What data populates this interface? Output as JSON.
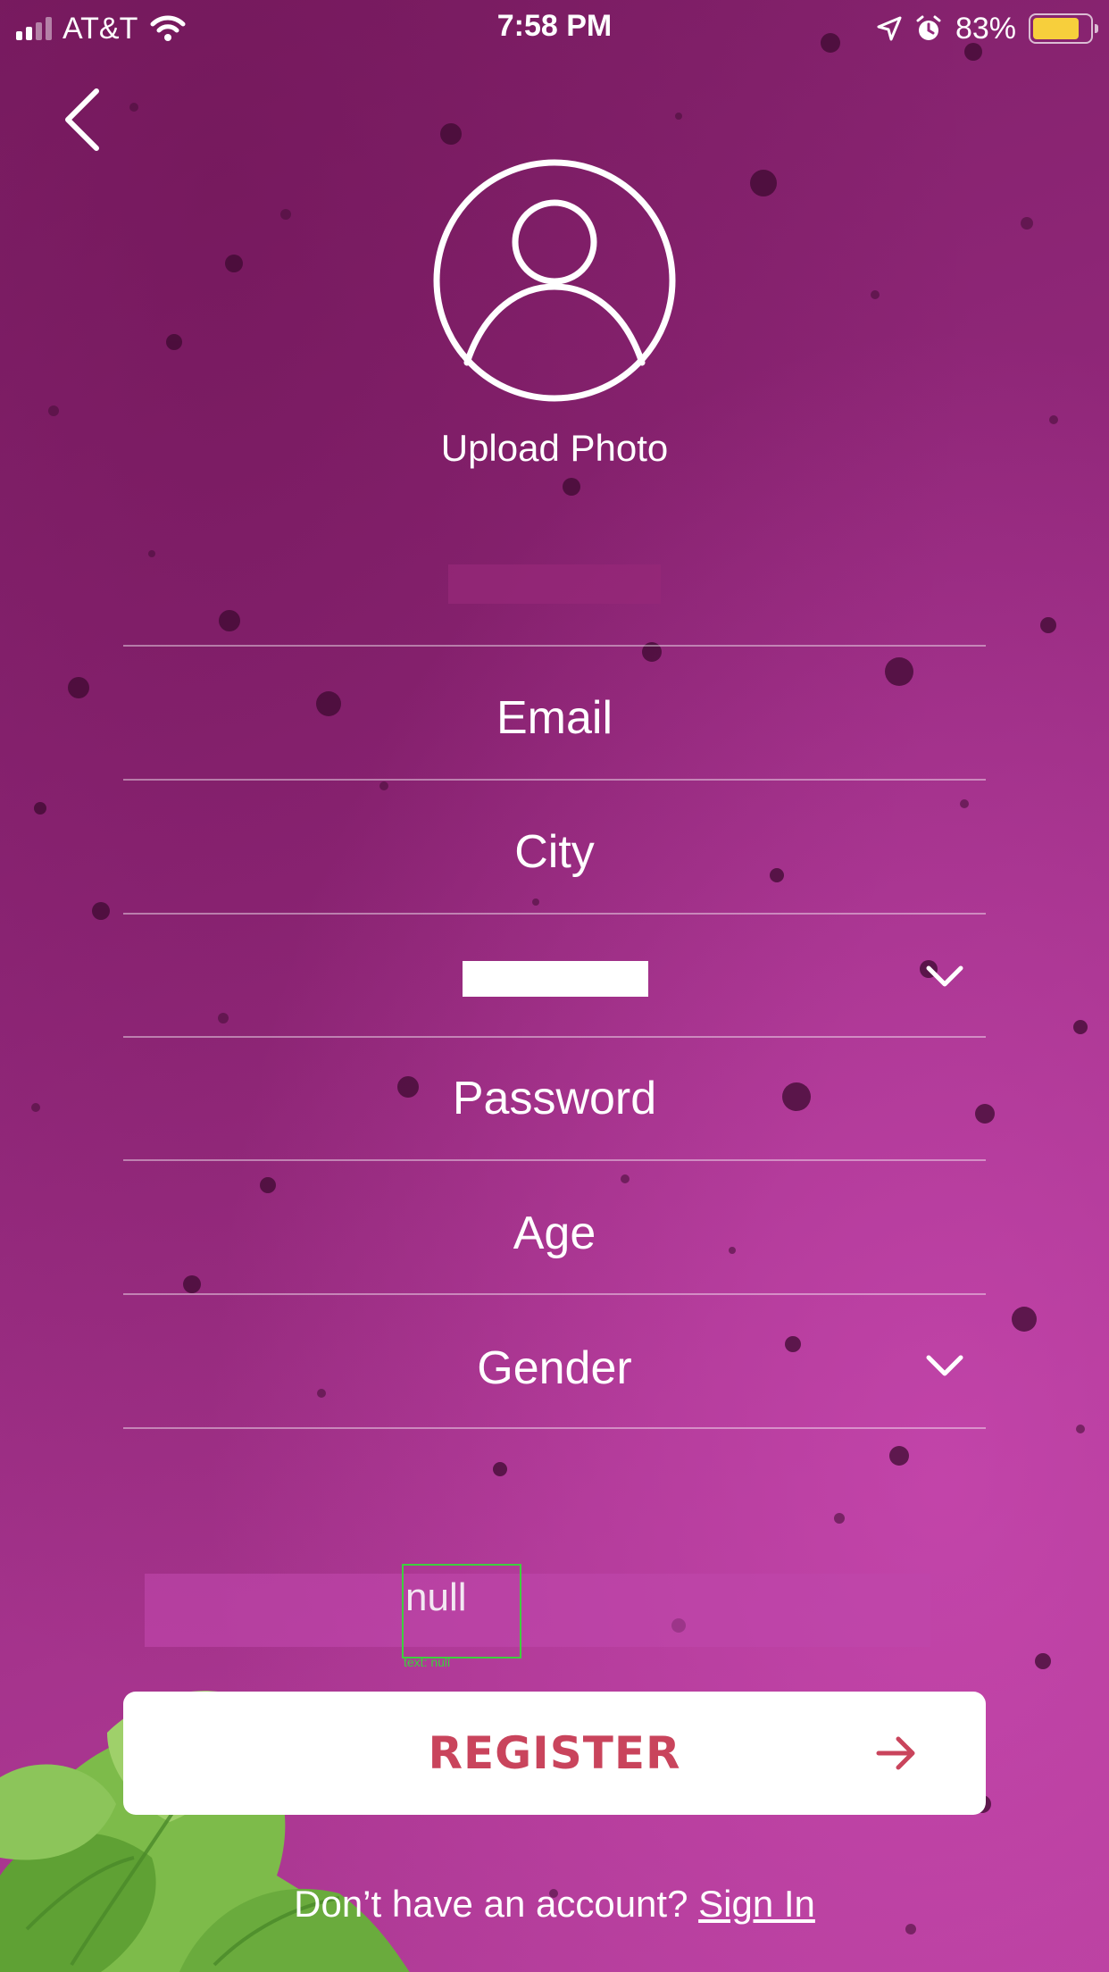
{
  "status_bar": {
    "carrier": "AT&T",
    "time": "7:58 PM",
    "battery_percent": "83%",
    "battery_level": 0.83,
    "icons": [
      "signal-icon",
      "wifi-icon",
      "location-icon",
      "alarm-icon",
      "battery-icon"
    ]
  },
  "nav": {
    "back_icon": "chevron-left-icon"
  },
  "avatar": {
    "icon": "user-circle-icon",
    "label": "Upload Photo"
  },
  "form": {
    "email_placeholder": "Email",
    "city_placeholder": "City",
    "password_placeholder": "Password",
    "age_placeholder": "Age",
    "gender_placeholder": "Gender",
    "dropdown_icon": "chevron-down-icon"
  },
  "debug": {
    "null_text": "null",
    "overlay_label": "text: null"
  },
  "register": {
    "label": "REGISTER",
    "icon": "arrow-right-icon"
  },
  "footer": {
    "prompt": "Don’t have an account?",
    "link": "Sign In"
  },
  "colors": {
    "background": "#93287c",
    "accent": "#c9445c",
    "battery": "#f7cf3c"
  }
}
